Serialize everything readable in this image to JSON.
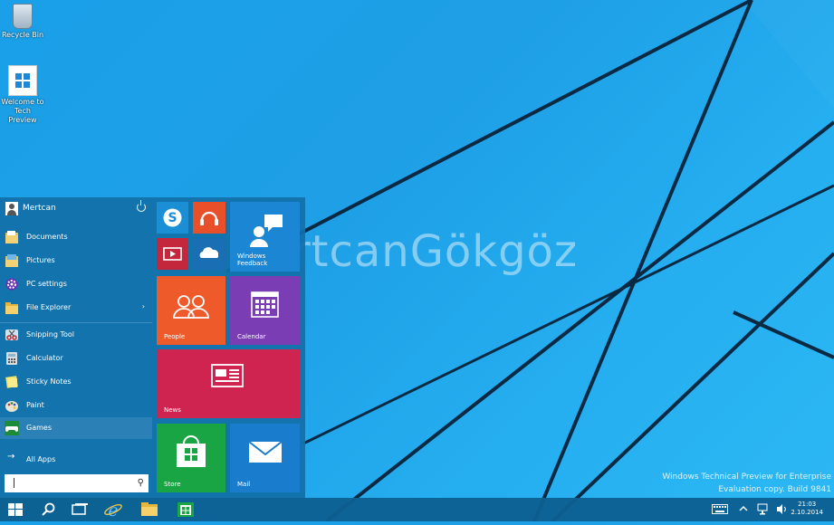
{
  "desktop": {
    "icons": [
      {
        "label": "Recycle Bin",
        "icon": "recycle-bin-icon"
      },
      {
        "label": "Welcome to Tech Preview",
        "icon": "windows-logo-icon"
      }
    ],
    "watermark_text": "MertcanGökgöz",
    "eval_line1": "Windows Technical Preview for Enterprise",
    "eval_line2": "Evaluation copy. Build 9841"
  },
  "start_menu": {
    "user_name": "Mertcan",
    "places": [
      {
        "label": "Documents",
        "icon": "documents-folder-icon"
      },
      {
        "label": "Pictures",
        "icon": "pictures-folder-icon"
      },
      {
        "label": "PC settings",
        "icon": "gear-icon"
      },
      {
        "label": "File Explorer",
        "icon": "folder-icon",
        "has_arrow": true
      }
    ],
    "apps": [
      {
        "label": "Snipping Tool",
        "icon": "scissors-icon"
      },
      {
        "label": "Calculator",
        "icon": "calculator-icon"
      },
      {
        "label": "Sticky Notes",
        "icon": "note-icon"
      },
      {
        "label": "Paint",
        "icon": "palette-icon"
      },
      {
        "label": "Games",
        "icon": "gamepad-icon"
      }
    ],
    "all_apps_label": "All Apps",
    "search_placeholder": "",
    "tiles": [
      {
        "label": "",
        "icon": "skype-icon",
        "color": "#1a8fd6"
      },
      {
        "label": "",
        "icon": "music-icon",
        "color": "#e8502a"
      },
      {
        "label": "",
        "icon": "video-icon",
        "color": "#c4273c"
      },
      {
        "label": "",
        "icon": "onedrive-icon",
        "color": "#1a6fb4"
      },
      {
        "label": "Windows Feedback",
        "icon": "feedback-icon",
        "color": "#1a86d4"
      },
      {
        "label": "People",
        "icon": "people-icon",
        "color": "#ee5a2a"
      },
      {
        "label": "Calendar",
        "icon": "calendar-icon",
        "color": "#7a3db4"
      },
      {
        "label": "News",
        "icon": "news-icon",
        "color": "#d02450"
      },
      {
        "label": "Store",
        "icon": "store-icon",
        "color": "#1aa544"
      },
      {
        "label": "Mail",
        "icon": "mail-icon",
        "color": "#1a7ccc"
      }
    ]
  },
  "taskbar": {
    "buttons": [
      {
        "icon": "windows-start-icon"
      },
      {
        "icon": "search-icon"
      },
      {
        "icon": "task-view-icon"
      },
      {
        "icon": "internet-explorer-icon"
      },
      {
        "icon": "file-explorer-icon"
      },
      {
        "icon": "store-icon"
      }
    ],
    "clock_time": "21:03",
    "clock_date": "2.10.2014"
  },
  "colors": {
    "accent": "#1e9fe6",
    "start_bg": "#1270a8",
    "taskbar_bg": "#0c6091"
  }
}
